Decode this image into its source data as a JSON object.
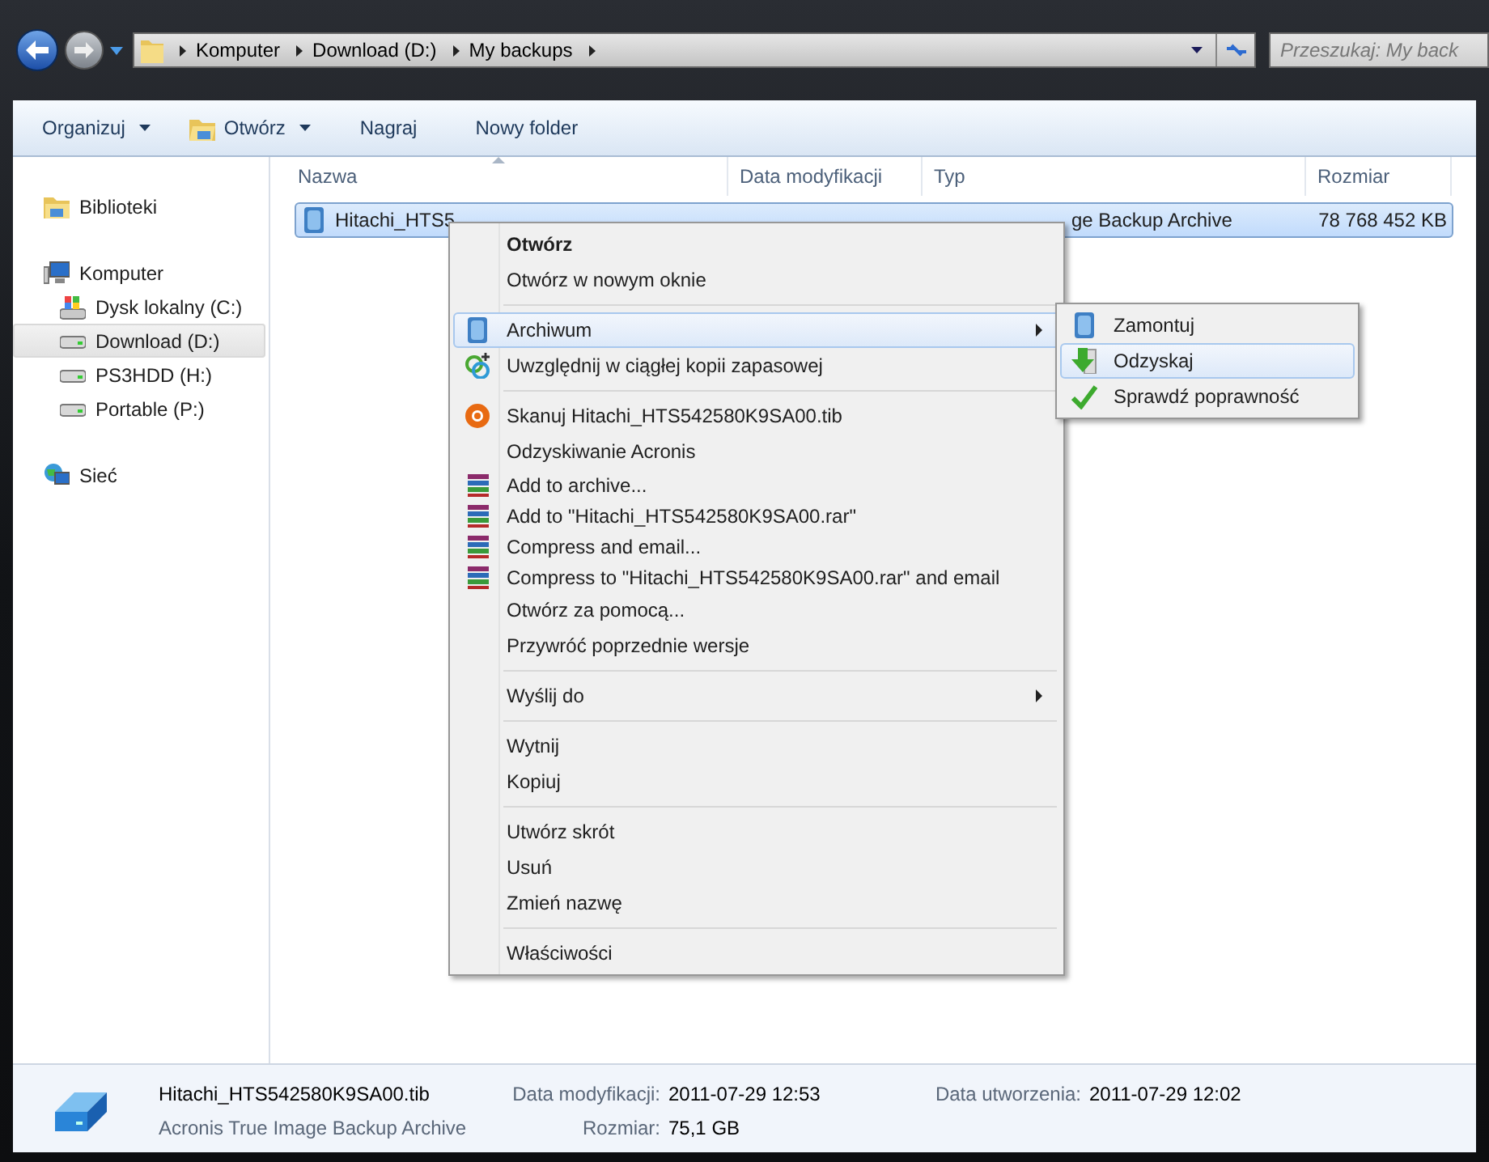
{
  "address_bar": {
    "crumbs": [
      "Komputer",
      "Download (D:)",
      "My backups"
    ]
  },
  "search": {
    "placeholder": "Przeszukaj: My back"
  },
  "toolbar": [
    {
      "label": "Organizuj",
      "kind": "dropdown"
    },
    {
      "label": "Otwórz",
      "kind": "folder-dropdown"
    },
    {
      "label": "Nagraj",
      "kind": "plain"
    },
    {
      "label": "Nowy folder",
      "kind": "plain"
    }
  ],
  "sidebar": {
    "items": [
      {
        "label": "Biblioteki",
        "kind": "library",
        "selected": false
      },
      {
        "label": "Komputer",
        "kind": "computer",
        "selected": false,
        "children": [
          {
            "label": "Dysk lokalny (C:)",
            "kind": "system-drive",
            "selected": false
          },
          {
            "label": "Download (D:)",
            "kind": "drive",
            "selected": true
          },
          {
            "label": "PS3HDD (H:)",
            "kind": "drive",
            "selected": false
          },
          {
            "label": "Portable (P:)",
            "kind": "drive",
            "selected": false
          }
        ]
      },
      {
        "label": "Sieć",
        "kind": "network",
        "selected": false
      }
    ]
  },
  "table": {
    "columns": [
      "Nazwa",
      "Data modyfikacji",
      "Typ",
      "Rozmiar"
    ],
    "rows": [
      {
        "name": "Hitachi_HTS5",
        "type": "ge Backup Archive",
        "size": "78 768 452 KB",
        "selected": true
      }
    ]
  },
  "context_menu": {
    "items": [
      {
        "label": "Otwórz",
        "kind": "default"
      },
      {
        "label": "Otwórz w nowym oknie",
        "kind": "plain"
      },
      {
        "kind": "separator"
      },
      {
        "label": "Archiwum",
        "kind": "disk",
        "submenu": true,
        "highlighted": true
      },
      {
        "label": "Uwzględnij w ciągłej kopii zapasowej",
        "kind": "sync"
      },
      {
        "kind": "separator"
      },
      {
        "label": "Skanuj Hitachi_HTS542580K9SA00.tib",
        "kind": "scan"
      },
      {
        "label": "Odzyskiwanie Acronis",
        "kind": "plain"
      },
      {
        "label": "Add to archive...",
        "kind": "rar"
      },
      {
        "label": "Add to \"Hitachi_HTS542580K9SA00.rar\"",
        "kind": "rar"
      },
      {
        "label": "Compress and email...",
        "kind": "rar"
      },
      {
        "label": "Compress to \"Hitachi_HTS542580K9SA00.rar\" and email",
        "kind": "rar"
      },
      {
        "label": "Otwórz za pomocą...",
        "kind": "plain"
      },
      {
        "label": "Przywróć poprzednie wersje",
        "kind": "plain"
      },
      {
        "kind": "separator"
      },
      {
        "label": "Wyślij do",
        "kind": "plain",
        "submenu": true,
        "highlighted": false
      },
      {
        "kind": "separator"
      },
      {
        "label": "Wytnij",
        "kind": "plain"
      },
      {
        "label": "Kopiuj",
        "kind": "plain"
      },
      {
        "kind": "separator"
      },
      {
        "label": "Utwórz skrót",
        "kind": "plain"
      },
      {
        "label": "Usuń",
        "kind": "plain"
      },
      {
        "label": "Zmień nazwę",
        "kind": "plain"
      },
      {
        "kind": "separator"
      },
      {
        "label": "Właściwości",
        "kind": "plain"
      }
    ]
  },
  "submenu": {
    "items": [
      {
        "label": "Zamontuj",
        "kind": "disk",
        "highlighted": false
      },
      {
        "label": "Odzyskaj",
        "kind": "down-arrow",
        "highlighted": true
      },
      {
        "label": "Sprawdź poprawność",
        "kind": "check",
        "highlighted": false
      }
    ]
  },
  "details_pane": {
    "name": "Hitachi_HTS542580K9SA00.tib",
    "type": "Acronis True Image Backup Archive",
    "fields": [
      {
        "label": "Data modyfikacji:",
        "value": "2011-07-29 12:53"
      },
      {
        "label": "Rozmiar:",
        "value": "75,1 GB"
      },
      {
        "label": "Data utworzenia:",
        "value": "2011-07-29 12:02"
      }
    ]
  }
}
